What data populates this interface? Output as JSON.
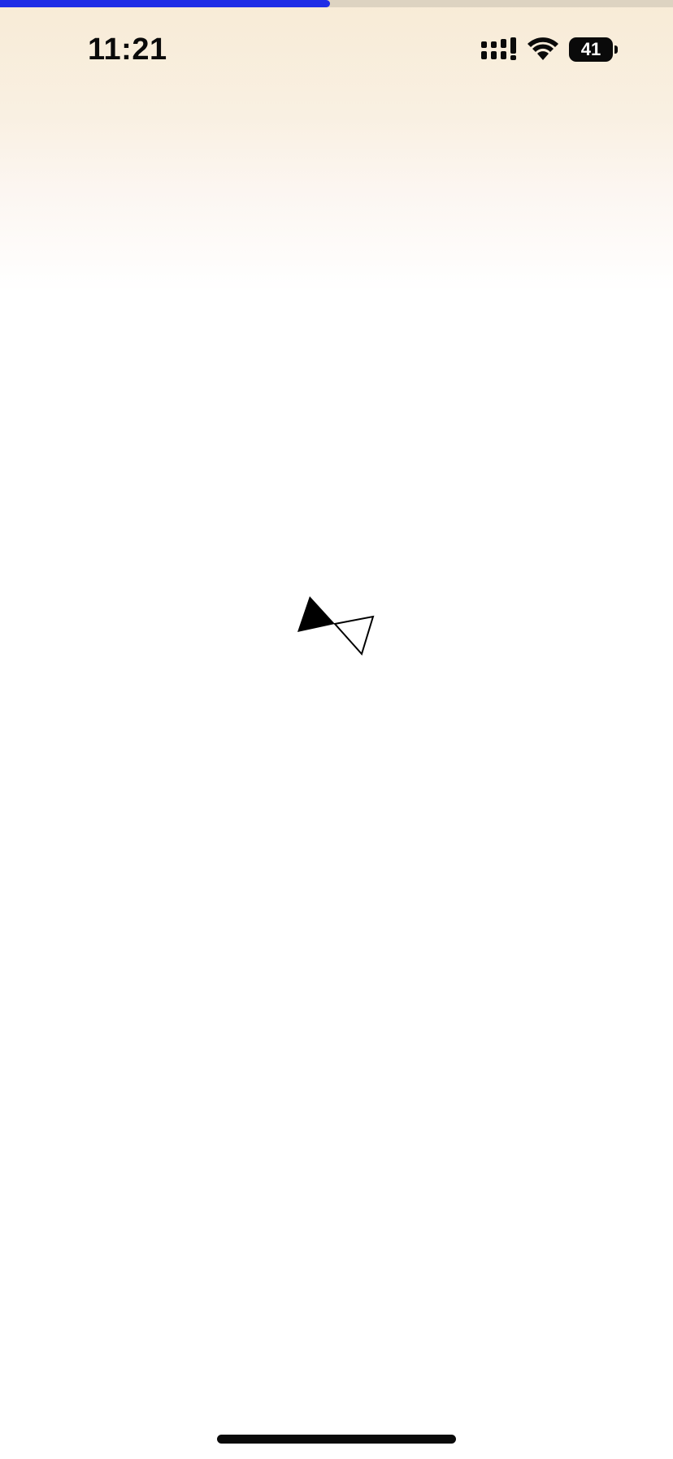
{
  "progress": {
    "fraction": 0.49,
    "fill_color": "#1f2de6",
    "track_color": "#ddd3c1"
  },
  "status_bar": {
    "time": "11:21",
    "battery_level": "41",
    "icons": [
      "signal-icon",
      "wifi-icon",
      "battery-icon"
    ]
  },
  "loader": {
    "icon": "bowtie-loading-icon",
    "colors": {
      "filled": "#000000",
      "outline": "#000000"
    }
  },
  "colors": {
    "gradient_top": "#f8ebd6",
    "background": "#ffffff"
  }
}
